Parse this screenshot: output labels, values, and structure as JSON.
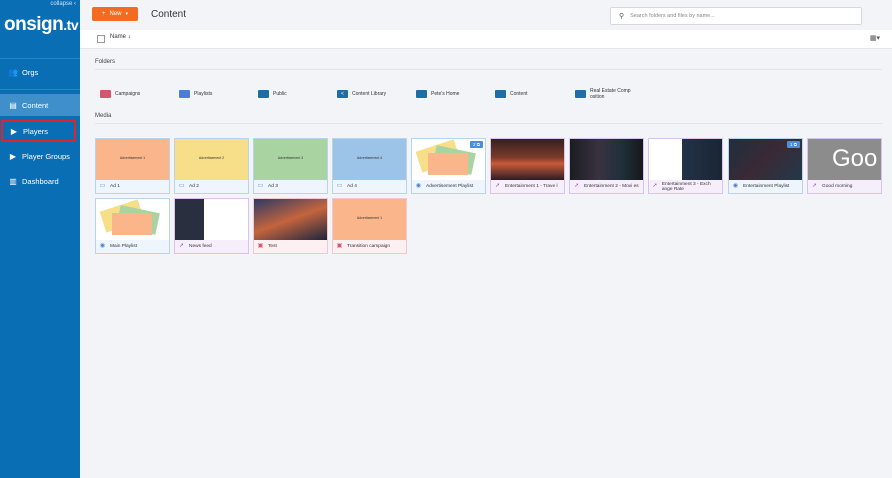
{
  "sidebar": {
    "collapse_label": "collapse",
    "logo_main": "onsign",
    "logo_sub": ".tv",
    "items": [
      {
        "label": "Orgs",
        "icon": "users-icon"
      },
      {
        "label": "Content",
        "icon": "content-icon"
      },
      {
        "label": "Players",
        "icon": "play-icon"
      },
      {
        "label": "Player Groups",
        "icon": "play-icon"
      },
      {
        "label": "Dashboard",
        "icon": "chart-icon"
      }
    ]
  },
  "header": {
    "new_label": "New",
    "title": "Content",
    "search_placeholder": "Search folders and files by name..."
  },
  "sortbar": {
    "sort_label": "Name"
  },
  "folders_section": {
    "title": "Folders",
    "items": [
      {
        "label": "Campaigns",
        "color": "#d2566e"
      },
      {
        "label": "Playlists",
        "color": "#4a7fd4"
      },
      {
        "label": "Public",
        "color": "#1b6ea8"
      },
      {
        "label": "Content Library",
        "color": "#1b6ea8"
      },
      {
        "label": "Pete's Home",
        "color": "#1b6ea8"
      },
      {
        "label": "Content",
        "color": "#1b6ea8"
      },
      {
        "label": "Real Estate Comp\nosition",
        "color": "#1b6ea8"
      }
    ]
  },
  "media_section": {
    "title": "Media",
    "items": [
      {
        "label": "Ad 1",
        "thumb_text": "Advertisement 1"
      },
      {
        "label": "Ad 2",
        "thumb_text": "Advertisement 2"
      },
      {
        "label": "Ad 3",
        "thumb_text": "Advertisement 3"
      },
      {
        "label": "Ad 4",
        "thumb_text": "Advertisement 4"
      },
      {
        "label": "Advertisement Playlist",
        "badge": "2 ⧉"
      },
      {
        "label": "Entertainment 1 - Trave l"
      },
      {
        "label": "Entertainment 2 - Movi es"
      },
      {
        "label": "Entertainment 3 - Exch ange Rate"
      },
      {
        "label": "Entertainment Playlist",
        "badge": "1 ⧉"
      },
      {
        "label": "Good morning",
        "thumb_text": "Goo"
      },
      {
        "label": "Main Playlist"
      },
      {
        "label": "News feed"
      },
      {
        "label": "Test"
      },
      {
        "label": "Transition campaign",
        "thumb_text": "Advertisement 1"
      }
    ]
  },
  "colors": {
    "sidebar_bg": "#0a6eb4",
    "accent": "#f26b21",
    "highlight_box": "#e0242b"
  }
}
